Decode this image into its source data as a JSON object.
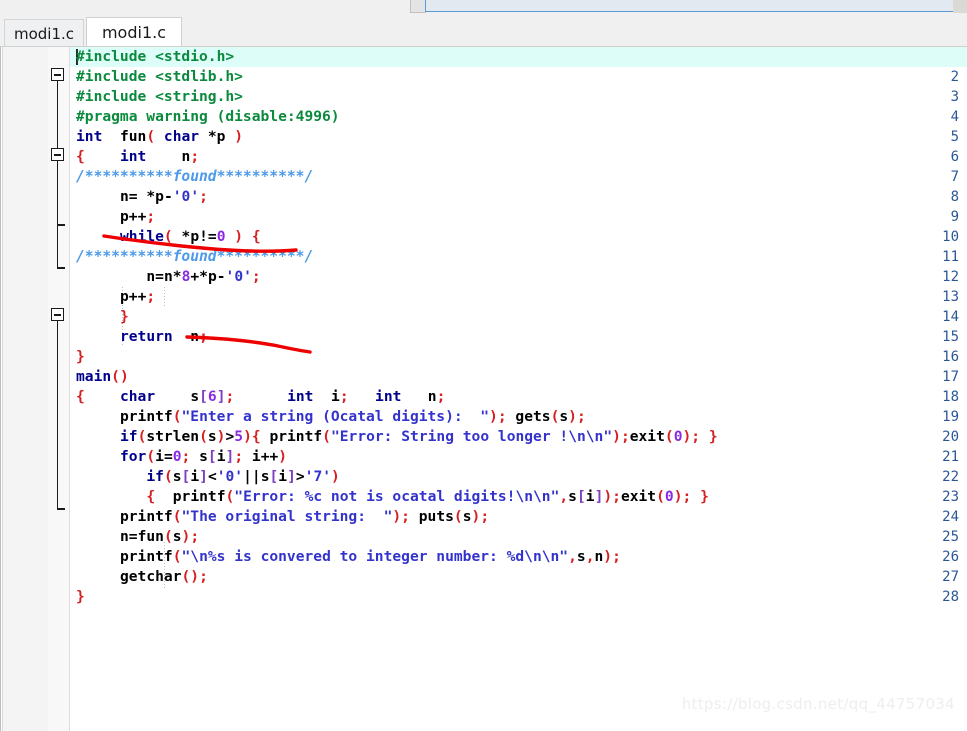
{
  "window": {
    "title": "modi1.c",
    "toolbar": {
      "search_value": ""
    }
  },
  "tabs": [
    {
      "label": "modi1.c",
      "active": false
    },
    {
      "label": "modi1.c",
      "active": true
    }
  ],
  "editor": {
    "highlighted_line": 1,
    "caret_line": 1,
    "caret_column": 1,
    "total_lines": 28,
    "line_numbers": [
      1,
      2,
      3,
      4,
      5,
      6,
      7,
      8,
      9,
      10,
      11,
      12,
      13,
      14,
      15,
      16,
      17,
      18,
      19,
      20,
      21,
      22,
      23,
      24,
      25,
      26,
      27,
      28
    ],
    "lines": [
      {
        "n": 1,
        "text": "#include <stdio.h>"
      },
      {
        "n": 2,
        "text": "#include <stdlib.h>"
      },
      {
        "n": 3,
        "text": "#include <string.h>"
      },
      {
        "n": 4,
        "text": "#pragma warning (disable:4996)"
      },
      {
        "n": 5,
        "text": "int  fun( char *p )"
      },
      {
        "n": 6,
        "text": "{    int    n;"
      },
      {
        "n": 7,
        "text": "/**********found**********/"
      },
      {
        "n": 8,
        "text": "     n= *p-'0';"
      },
      {
        "n": 9,
        "text": "     p++;"
      },
      {
        "n": 10,
        "text": "     while( *p!=0 ) {"
      },
      {
        "n": 11,
        "text": "/**********found**********/"
      },
      {
        "n": 12,
        "text": "        n=n*8+*p-'0';"
      },
      {
        "n": 13,
        "text": "     p++;"
      },
      {
        "n": 14,
        "text": "     }"
      },
      {
        "n": 15,
        "text": "     return  n;"
      },
      {
        "n": 16,
        "text": "}"
      },
      {
        "n": 17,
        "text": "main()"
      },
      {
        "n": 18,
        "text": "{    char    s[6];      int  i;   int   n;"
      },
      {
        "n": 19,
        "text": "     printf(\"Enter a string (Ocatal digits):  \"); gets(s);"
      },
      {
        "n": 20,
        "text": "     if(strlen(s)>5){ printf(\"Error: String too longer !\\n\\n\");exit(0); }"
      },
      {
        "n": 21,
        "text": "     for(i=0; s[i]; i++)"
      },
      {
        "n": 22,
        "text": "        if(s[i]<'0'||s[i]>'7')"
      },
      {
        "n": 23,
        "text": "        {  printf(\"Error: %c not is ocatal digits!\\n\\n\",s[i]);exit(0); }"
      },
      {
        "n": 24,
        "text": "     printf(\"The original string:  \"); puts(s);"
      },
      {
        "n": 25,
        "text": "     n=fun(s);"
      },
      {
        "n": 26,
        "text": "     printf(\"\\n%s is convered to integer number: %d\\n\\n\",s,n);"
      },
      {
        "n": 27,
        "text": "     getchar();"
      },
      {
        "n": 28,
        "text": "}"
      }
    ],
    "fold_markers": [
      {
        "line": 6,
        "type": "collapse-box"
      },
      {
        "line": 10,
        "type": "collapse-box"
      },
      {
        "line": 14,
        "type": "branch-tick"
      },
      {
        "line": 16,
        "type": "region-end"
      },
      {
        "line": 18,
        "type": "collapse-box"
      },
      {
        "line": 28,
        "type": "region-end"
      }
    ],
    "annotations": [
      {
        "name": "red-underline-1",
        "note": "hand-drawn red underline under line 8 / line 9"
      },
      {
        "name": "red-underline-2",
        "note": "hand-drawn red underline right of line 13"
      }
    ]
  },
  "colors": {
    "preprocessor": "#0b8a3e",
    "keyword": "#00008B",
    "string": "#3333cc",
    "punctuation": "#d62020",
    "number": "#8a2be2",
    "comment": "#4d9ae8",
    "bracket": "#7d3fbf",
    "current_line_highlight": "#ddfdf9",
    "annotation_red": "#ee0000"
  },
  "watermark": {
    "text": "https://blog.csdn.net/qq_44757034"
  }
}
